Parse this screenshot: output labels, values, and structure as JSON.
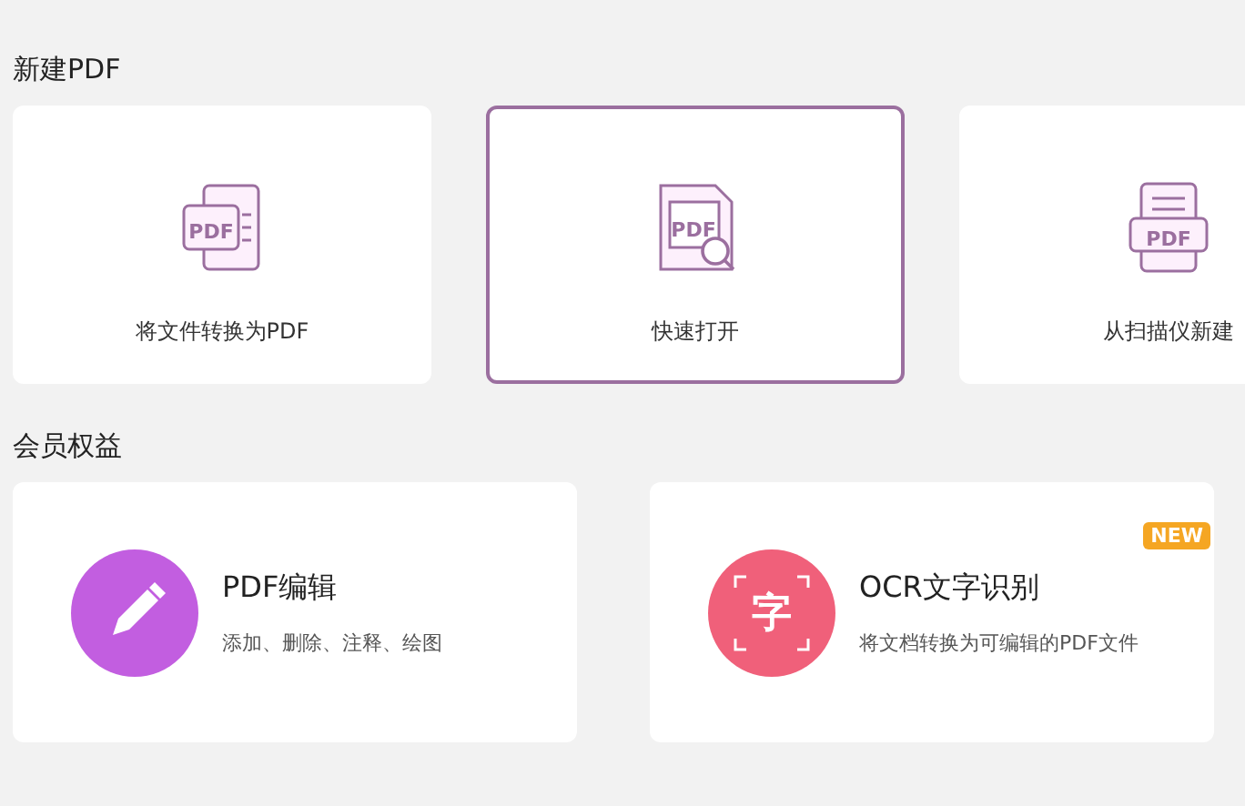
{
  "sections": [
    {
      "title": "新建PDF",
      "kind": "actions",
      "cards": [
        {
          "label": "将文件转换为PDF",
          "kind": "convert",
          "icon_text": "PDF",
          "selected": false
        },
        {
          "label": "快速打开",
          "kind": "open",
          "icon_text": "PDF",
          "selected": true
        },
        {
          "label": "从扫描仪新建",
          "kind": "scan",
          "icon_text": "PDF",
          "selected": false
        }
      ]
    },
    {
      "title": "会员权益",
      "kind": "features",
      "cards": [
        {
          "title": "PDF编辑",
          "description": "添加、删除、注释、绘图",
          "kind": "edit",
          "color": "#c25ee0"
        },
        {
          "title": "OCR文字识别",
          "description": "将文档转换为可编辑的PDF文件",
          "kind": "ocr",
          "icon_text": "字",
          "color": "#f0607a",
          "badge": "NEW"
        }
      ]
    }
  ]
}
